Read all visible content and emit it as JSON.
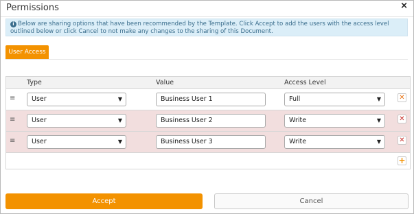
{
  "dialog": {
    "title": "Permissions",
    "close_glyph": "×",
    "info_icon": "info-icon",
    "info_text": "Below are sharing options that have been recommended by the Template. Click Accept to add the users with the access level outlined below or click Cancel to not make any changes to the sharing of this Document."
  },
  "tabs": [
    {
      "label": "User Access"
    }
  ],
  "table": {
    "headers": {
      "type": "Type",
      "value": "Value",
      "access": "Access Level"
    },
    "rows": [
      {
        "type": "User",
        "value": "Business User 1",
        "access": "Full"
      },
      {
        "type": "User",
        "value": "Business User 2",
        "access": "Write"
      },
      {
        "type": "User",
        "value": "Business User 3",
        "access": "Write"
      }
    ]
  },
  "actions": {
    "accept": "Accept",
    "cancel": "Cancel"
  },
  "colors": {
    "accent": "#f39200",
    "info_bg": "#dbeef8",
    "row_highlight": "#f2dede",
    "delete_red": "#c9302c"
  }
}
